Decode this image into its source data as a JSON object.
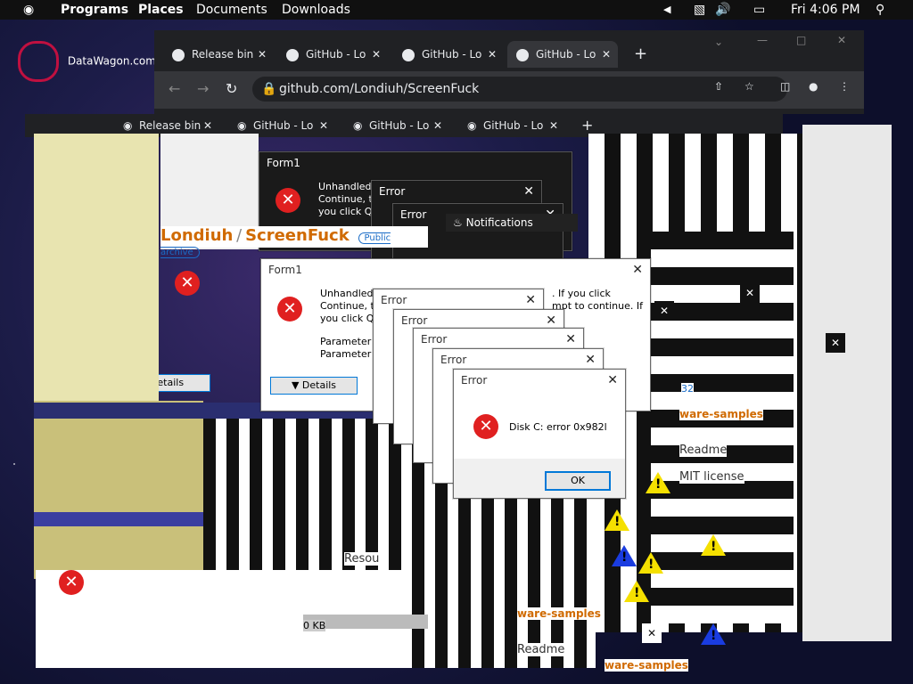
{
  "topbar": {
    "programs": "Programs",
    "places": "Places",
    "documents": "Documents",
    "downloads": "Downloads",
    "clock": "Fri 4:06 PM"
  },
  "desktop": {
    "logo_text": "DataWagon.com"
  },
  "browser": {
    "tabs": [
      {
        "label": "Release bin"
      },
      {
        "label": "GitHub - Lo"
      },
      {
        "label": "GitHub - Lo"
      },
      {
        "label": "GitHub - Lo"
      }
    ],
    "url": "github.com/Londiuh/ScreenFuck",
    "repo_owner": "Londiuh",
    "repo_sep": "/",
    "repo_name": "ScreenFuck",
    "public_badge": "Public archive",
    "notifications": "Notifications",
    "readme": "Readme",
    "license": "MIT license",
    "samples": "ware-samples",
    "resources": "Resou",
    "size": "0 KB",
    "count": "32"
  },
  "dialogs": {
    "form_title": "Form1",
    "form_text_1": "Unhandled e",
    "form_text_2": "Continue, the",
    "form_text_3": "you click Qui",
    "form_text_4": "Parameter m",
    "form_text_5": "Parameter na",
    "form_right_1": ". If you click",
    "form_right_2": "mpt to continue. If",
    "details_label": "Details",
    "error_title": "Error",
    "error_message": "Disk C: error 0x982l",
    "ok_label": "OK"
  },
  "colors": {
    "error_red": "#e02020",
    "accent_blue": "#0078d7",
    "warn_yellow": "#f5e000",
    "orange": "#f07020"
  }
}
